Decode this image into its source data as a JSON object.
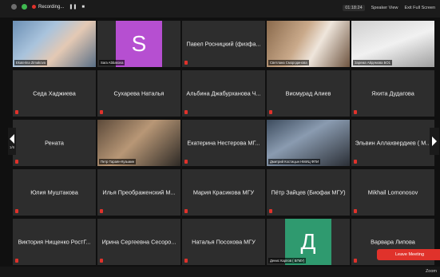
{
  "topbar": {
    "recording": "Recording...",
    "pause": "❚❚",
    "stop": "■",
    "timer": "01:18:24",
    "speaker_view": "Speaker View",
    "exit_full_screen": "Exit Full Screen"
  },
  "tiles": [
    {
      "kind": "video",
      "label": "Ekaterina Zimakova",
      "active": true
    },
    {
      "kind": "avatar",
      "initial": "S",
      "color": "#b64fd1",
      "label": "Sara Abbasova"
    },
    {
      "kind": "name",
      "name": "Павел Росницкий (физфа..."
    },
    {
      "kind": "video",
      "label": "Светлана Смородинова"
    },
    {
      "kind": "video",
      "label": "Зарема Айдемова БО1"
    },
    {
      "kind": "name",
      "name": "Седа Хаджиева"
    },
    {
      "kind": "name",
      "name": "Сухарева Наталья"
    },
    {
      "kind": "name",
      "name": "Альбина Джабурханова Ч..."
    },
    {
      "kind": "name",
      "name": "Висмурад Алиев"
    },
    {
      "kind": "name",
      "name": "Яхита Дудагова"
    },
    {
      "kind": "name",
      "name": "Рената"
    },
    {
      "kind": "video",
      "label": "Петр Тараян-Кузьмин"
    },
    {
      "kind": "name",
      "name": "Екатерина Нестерова МГ..."
    },
    {
      "kind": "video",
      "label": "Дмитрий Костицын НМИЦ ФПИ"
    },
    {
      "kind": "name",
      "name": "Эльвин Аллахвердиев ( М..."
    },
    {
      "kind": "name",
      "name": "Юлия Муштакова"
    },
    {
      "kind": "name",
      "name": "Илья Преображенский М..."
    },
    {
      "kind": "name",
      "name": "Мария Красикова МГУ"
    },
    {
      "kind": "name",
      "name": "Пётр Зайцев (Биофак МГУ)"
    },
    {
      "kind": "name",
      "name": "Mikhail Lomonosov"
    },
    {
      "kind": "name",
      "name": "Виктория Нищенко РостГ..."
    },
    {
      "kind": "name",
      "name": "Ирина Сергеевна Сесоро..."
    },
    {
      "kind": "name",
      "name": "Наталья Посохова МГУ"
    },
    {
      "kind": "avatar",
      "initial": "Д",
      "color": "#2f9a6f",
      "label": "Денис Карпов ( БГМУ)"
    },
    {
      "kind": "name",
      "name": "Варвара Липова"
    }
  ],
  "nav": {
    "page": "1/6"
  },
  "leave_label": "Leave Meeting",
  "bottom": {
    "zoom": "Zoom"
  }
}
